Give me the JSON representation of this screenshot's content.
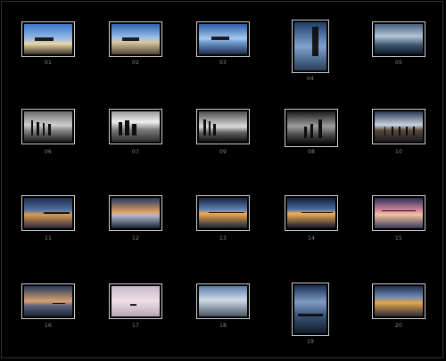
{
  "thumbnails": [
    {
      "number": "01"
    },
    {
      "number": "02"
    },
    {
      "number": "03"
    },
    {
      "number": "04"
    },
    {
      "number": "05"
    },
    {
      "number": "06"
    },
    {
      "number": "07"
    },
    {
      "number": "09"
    },
    {
      "number": "08"
    },
    {
      "number": "10"
    },
    {
      "number": "11"
    },
    {
      "number": "12"
    },
    {
      "number": "13"
    },
    {
      "number": "14"
    },
    {
      "number": "15"
    },
    {
      "number": "16"
    },
    {
      "number": "17"
    },
    {
      "number": "18"
    },
    {
      "number": "19"
    },
    {
      "number": "20"
    }
  ]
}
